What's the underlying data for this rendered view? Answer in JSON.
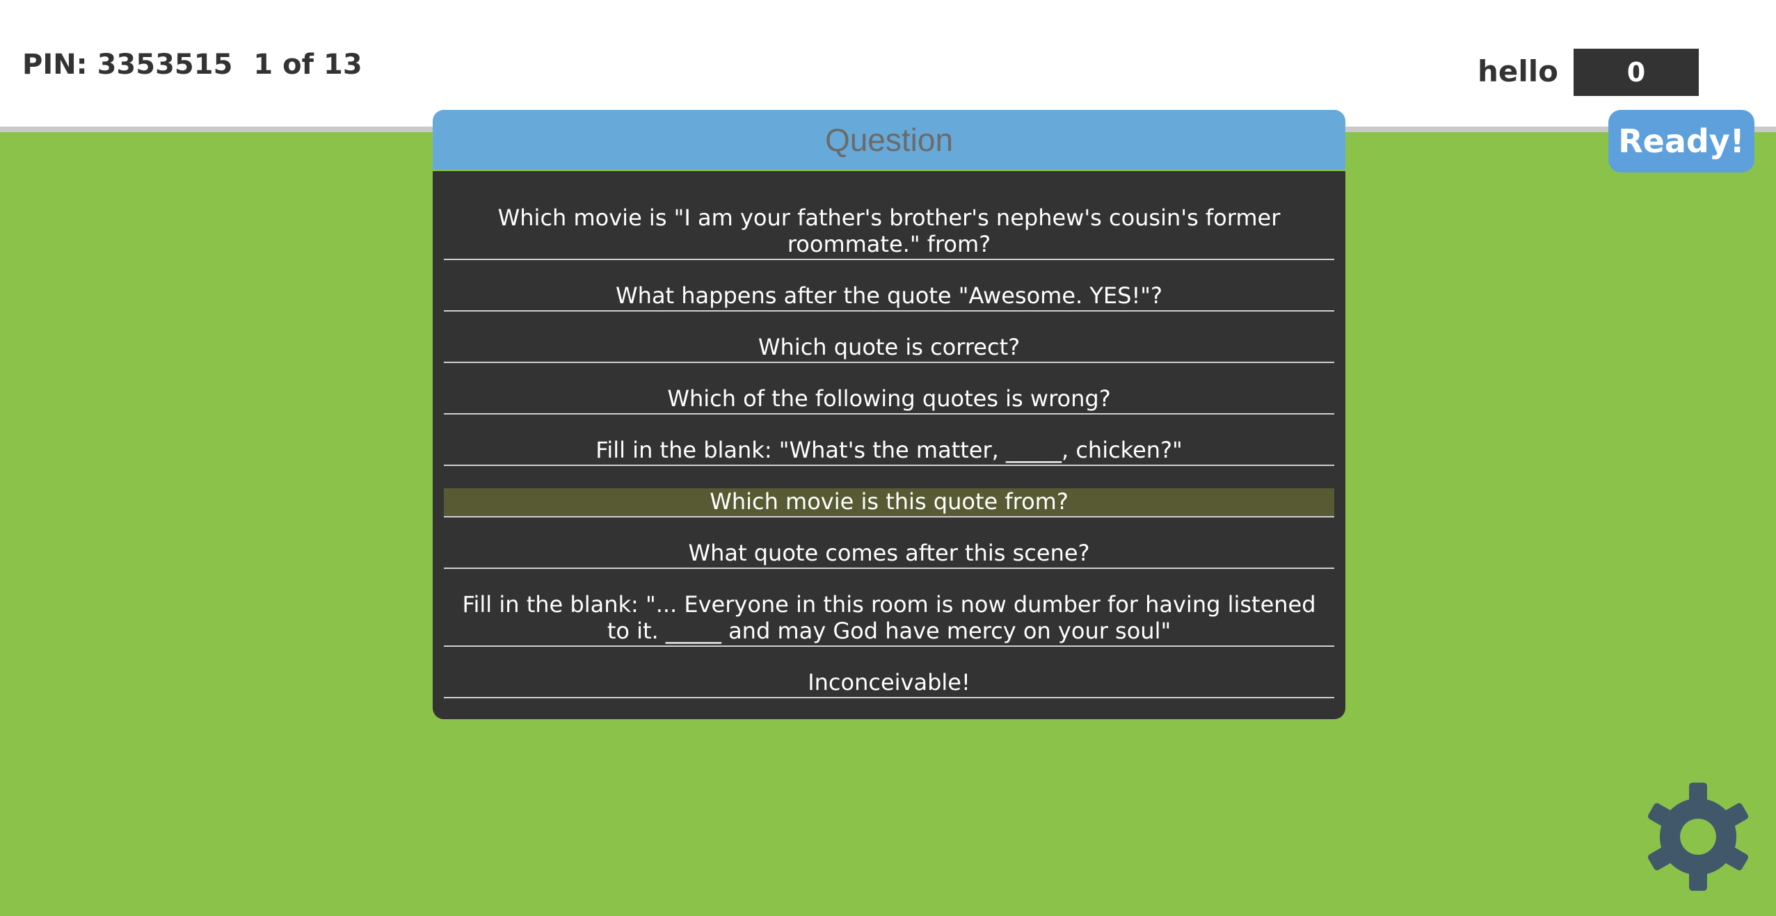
{
  "header": {
    "pin_label": "PIN: 3353515",
    "progress": "1 of 13",
    "player_name": "hello",
    "score": "0"
  },
  "ready_button": {
    "label": "Ready!"
  },
  "question_panel": {
    "title": "Question",
    "items": [
      {
        "text": "Which movie is \"I am your father's brother's nephew's cousin's former roommate.\" from?",
        "selected": false
      },
      {
        "text": "What happens after the quote \"Awesome. YES!\"?",
        "selected": false
      },
      {
        "text": "Which quote is correct?",
        "selected": false
      },
      {
        "text": "Which of the following quotes is wrong?",
        "selected": false
      },
      {
        "text": "Fill in the blank: \"What's the matter, _____, chicken?\"",
        "selected": false
      },
      {
        "text": "Which movie is this quote from?",
        "selected": true
      },
      {
        "text": "What quote comes after this scene?",
        "selected": false
      },
      {
        "text": "Fill in the blank: \"... Everyone in this room is now dumber for having listened to it. _____ and may God have mercy on your soul\"",
        "selected": false
      },
      {
        "text": "Inconceivable!",
        "selected": false
      }
    ]
  },
  "colors": {
    "background": "#8bc34a",
    "header_blue": "#67aad9",
    "button_blue": "#5da0dc",
    "panel": "#333333",
    "selected_row": "#575a33",
    "gear": "#40586a"
  },
  "icons": {
    "settings": "gear-icon"
  }
}
